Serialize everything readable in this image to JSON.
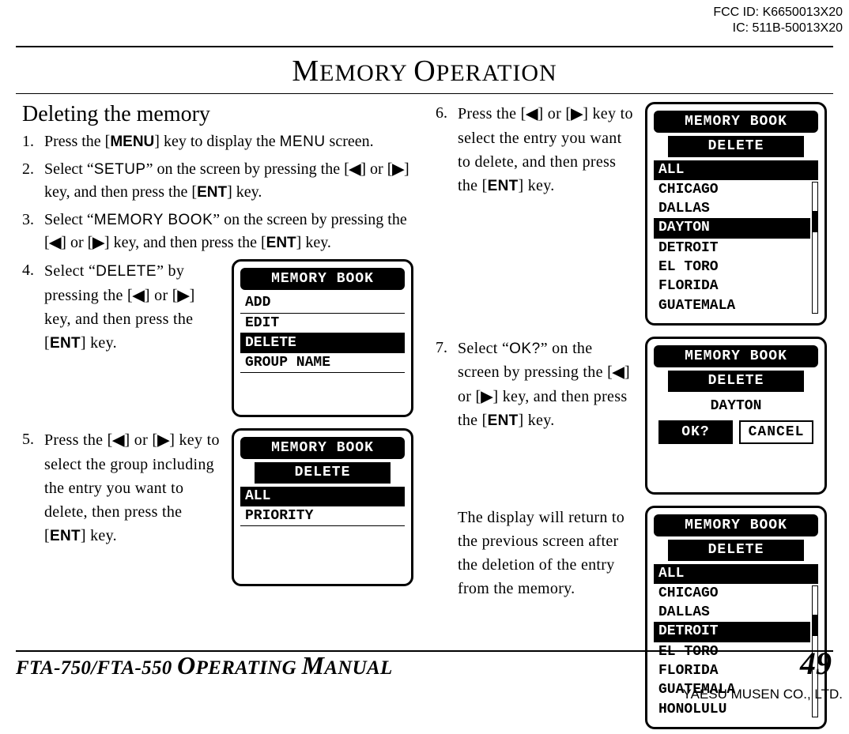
{
  "fcc": {
    "line1": "FCC ID: K6650013X20",
    "line2": "IC: 511B-50013X20"
  },
  "header": {
    "title": "MEMORY OPERATION"
  },
  "left": {
    "section_title": "Deleting the memory",
    "steps": {
      "s1": {
        "num": "1.",
        "text": "Press the [MENU] key to display the MENU screen."
      },
      "s2": {
        "num": "2.",
        "text": "Select \"SETUP\" on the screen by pressing the [◀] or [▶] key, and then press the [ENT] key."
      },
      "s3": {
        "num": "3.",
        "text": "Select \"MEMORY BOOK\" on the screen by pressing the [◀] or [▶] key, and then press the [ENT] key."
      },
      "s4": {
        "num": "4.",
        "text": "Select \"DELETE\" by pressing the [◀] or [▶] key, and then press the [ENT] key."
      },
      "s5": {
        "num": "5.",
        "text": "Press the [◀] or [▶] key to select the group including the entry you want to delete, then press the [ENT] key."
      }
    },
    "lcd4": {
      "title": "MEMORY BOOK",
      "items": [
        "ADD",
        "EDIT",
        "DELETE",
        "GROUP NAME"
      ],
      "selected": "DELETE"
    },
    "lcd5": {
      "title": "MEMORY BOOK",
      "sub": "DELETE",
      "items": [
        "ALL",
        "PRIORITY"
      ],
      "selected": "ALL"
    }
  },
  "right": {
    "steps": {
      "s6": {
        "num": "6.",
        "text": "Press the [◀] or [▶] key to select the entry you want to delete, and then press the [ENT] key."
      },
      "s7": {
        "num": "7.",
        "text": "Select \"OK?\" on the screen by pressing the [◀] or [▶] key, and then press the [ENT] key."
      },
      "final": "The display will return to the previous screen after the deletion of the entry from the memory."
    },
    "lcd6": {
      "title": "MEMORY BOOK",
      "sub": "DELETE",
      "header": "ALL",
      "items": [
        "CHICAGO",
        "DALLAS",
        "DAYTON",
        "DETROIT",
        "EL TORO",
        "FLORIDA",
        "GUATEMALA"
      ],
      "selected": "DAYTON",
      "thumb_top_pct": 22,
      "thumb_h_pct": 16
    },
    "lcd7": {
      "title": "MEMORY BOOK",
      "sub": "DELETE",
      "entry": "DAYTON",
      "ok": "OK?",
      "cancel": "CANCEL"
    },
    "lcd8": {
      "title": "MEMORY BOOK",
      "sub": "DELETE",
      "header": "ALL",
      "items": [
        "CHICAGO",
        "DALLAS",
        "DETROIT",
        "EL TORO",
        "FLORIDA",
        "GUATEMALA",
        "HONOLULU"
      ],
      "selected": "DETROIT",
      "thumb_top_pct": 22,
      "thumb_h_pct": 16
    }
  },
  "footer": {
    "manual": "FTA-750/FTA-550 OPERATING MANUAL",
    "page": "49",
    "company": "YAESU MUSEN CO., LTD."
  }
}
